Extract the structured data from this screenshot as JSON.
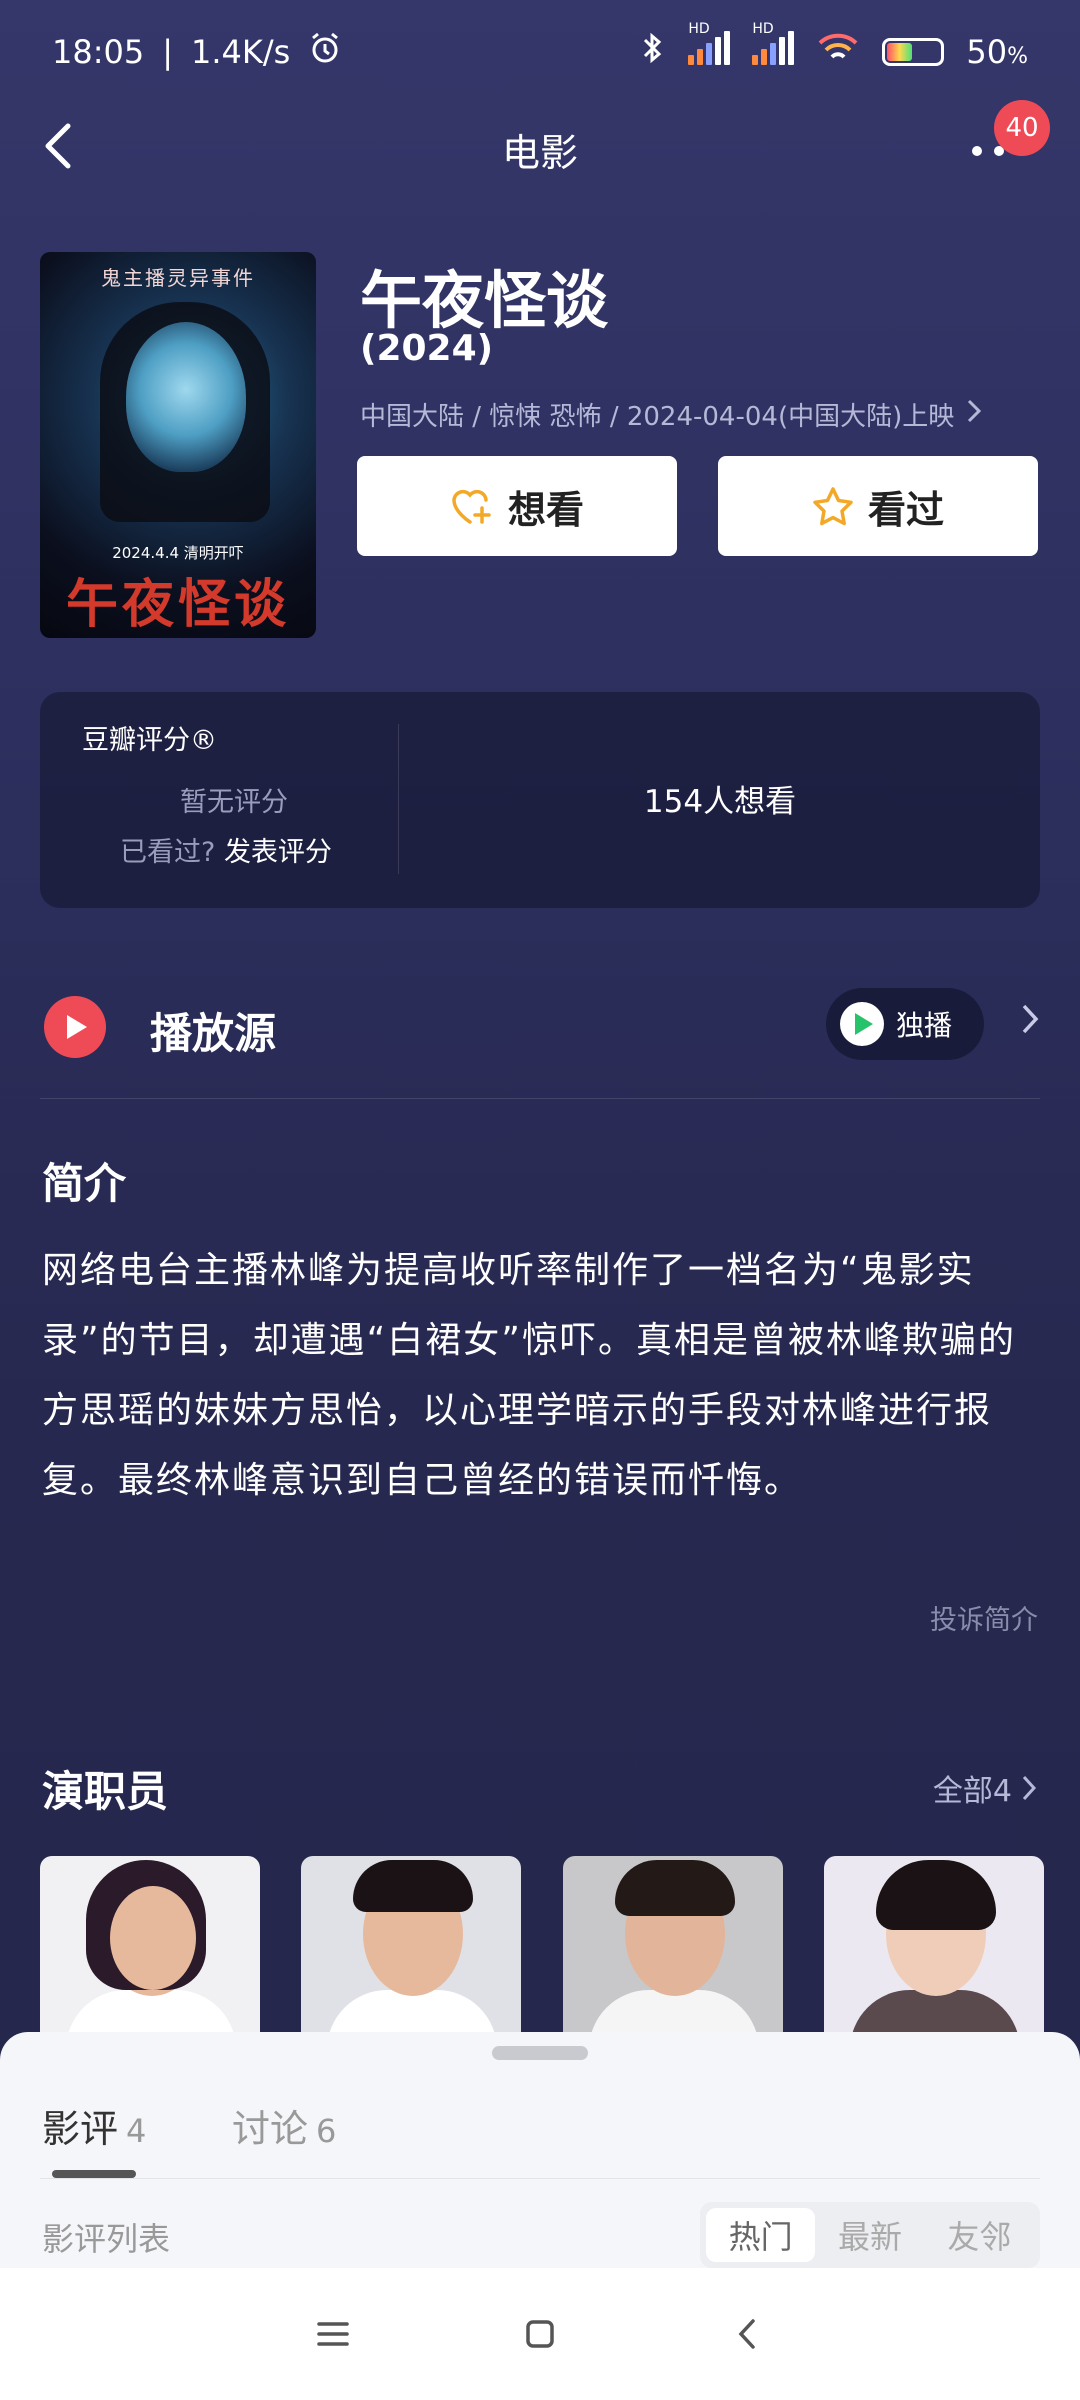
{
  "status_bar": {
    "time": "18:05",
    "net_speed": "1.4K/s",
    "battery": "50",
    "battery_unit": "%",
    "hd1": "HD",
    "hd2": "HD"
  },
  "nav": {
    "title": "电影",
    "badge_count": "40"
  },
  "movie": {
    "title": "午夜怪谈",
    "year": "(2024)",
    "meta": "中国大陆 / 惊悚 恐怖 / 2024-04-04(中国大陆)上映",
    "poster": {
      "top_text": "鬼主播灵异事件",
      "date_text": "2024.4.4 清明开吓",
      "logo_text": "午夜怪谈"
    }
  },
  "actions": {
    "want_label": "想看",
    "seen_label": "看过"
  },
  "rating": {
    "label": "豆瓣评分®",
    "none_text": "暂无评分",
    "prompt_text": "已看过?",
    "prompt_link": "发表评分",
    "wish_count": "154人想看"
  },
  "play_source": {
    "title": "播放源",
    "exclusive_label": "独播"
  },
  "synopsis": {
    "title": "简介",
    "text": "网络电台主播林峰为提高收听率制作了一档名为“鬼影实录”的节目，却遭遇“白裙女”惊吓。真相是曾被林峰欺骗的方思瑶的妹妹方思怡，以心理学暗示的手段对林峰进行报复。最终林峰意识到自己曾经的错误而忏悔。",
    "complain": "投诉简介"
  },
  "cast": {
    "title": "演职员",
    "all_label": "全部4"
  },
  "sheet": {
    "tabs": [
      {
        "label": "影评",
        "count": "4"
      },
      {
        "label": "讨论",
        "count": "6"
      }
    ],
    "list_label": "影评列表",
    "sort_options": [
      "热门",
      "最新",
      "友邻"
    ]
  },
  "colors": {
    "accent_red": "#ef4b57",
    "star_gold": "#f3a927",
    "bg": "#2d2f5e"
  }
}
